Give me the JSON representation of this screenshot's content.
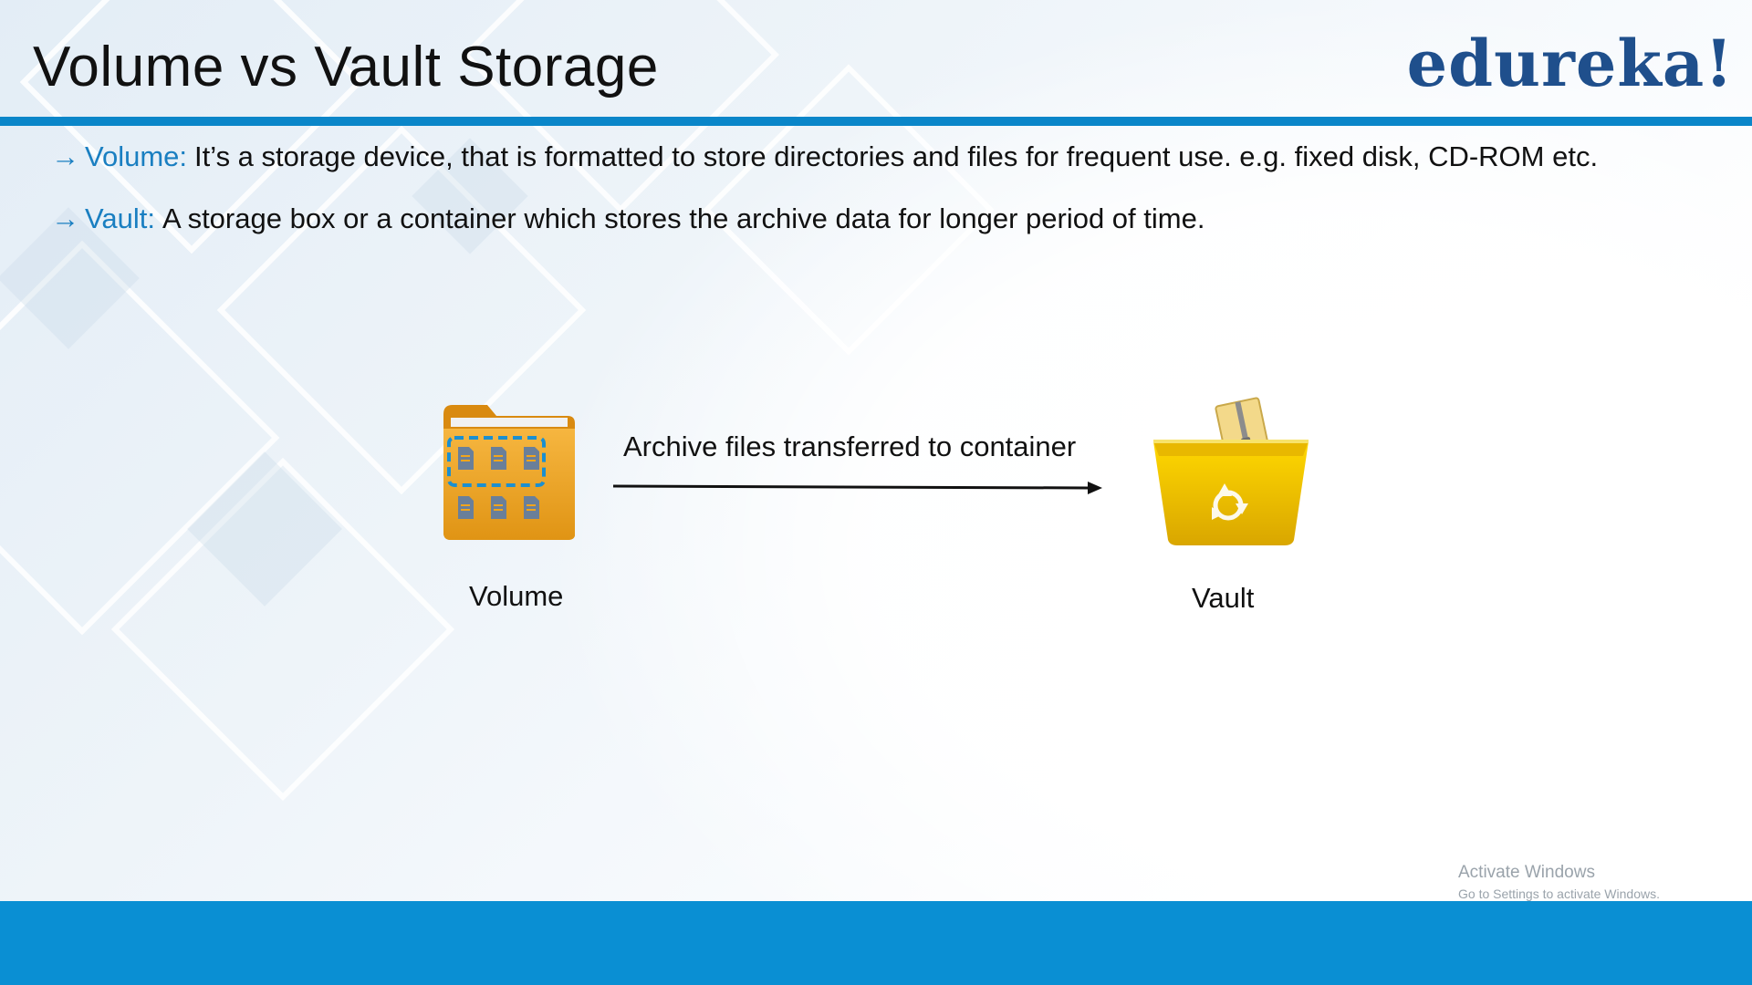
{
  "slide": {
    "title": "Volume vs Vault Storage",
    "logo_text": "edureka!"
  },
  "bullets": [
    {
      "arrow": "→",
      "term": "Volume:",
      "text": "It’s a storage device, that is formatted to store directories and files for frequent use. e.g. fixed disk, CD-ROM etc."
    },
    {
      "arrow": "→",
      "term": "Vault:",
      "text": "A storage box or a container which stores the archive data for longer period of time."
    }
  ],
  "diagram": {
    "arrow_label": "Archive files transferred to container",
    "source_label": "Volume",
    "target_label": "Vault",
    "source_icon": "folder-icon",
    "target_icon": "recycle-bin-icon"
  },
  "watermark": {
    "line1": "Activate Windows",
    "line2": "Go to Settings to activate Windows."
  },
  "colors": {
    "accent": "#0a86c9",
    "footer": "#0a8fd3",
    "term": "#1a7fc1",
    "logo": "#1f4f8c",
    "folder": "#f2a51c",
    "bin": "#f4c400"
  }
}
